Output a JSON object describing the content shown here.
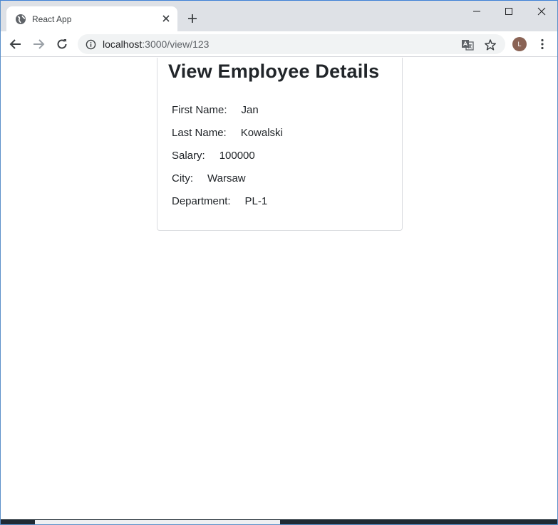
{
  "browser": {
    "tab": {
      "title": "React App",
      "favicon": "globe-icon"
    },
    "url": {
      "host": "localhost",
      "path": ":3000/view/123"
    },
    "profile_initial": "L"
  },
  "page": {
    "title": "View Employee Details",
    "fields": [
      {
        "label": "First Name:",
        "value": "Jan"
      },
      {
        "label": "Last Name:",
        "value": "Kowalski"
      },
      {
        "label": "Salary:",
        "value": "100000"
      },
      {
        "label": "City:",
        "value": "Warsaw"
      },
      {
        "label": "Department:",
        "value": "PL-1"
      }
    ]
  },
  "colors": {
    "tabstrip": "#dee1e6",
    "avatar": "#8a6355",
    "text": "#212529"
  }
}
